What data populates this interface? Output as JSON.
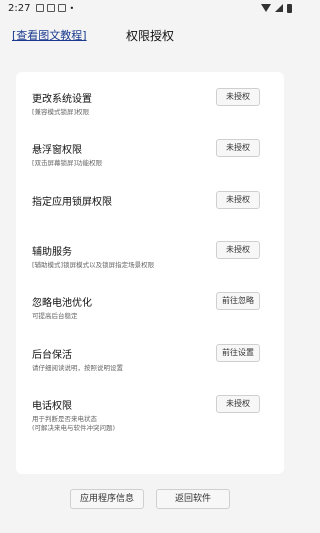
{
  "status_bar": {
    "time": "2:27",
    "icons": [
      "gallery-icon",
      "image-icon",
      "shield-icon",
      "dot-icon",
      "wifi-icon",
      "signal-icon",
      "battery-icon"
    ]
  },
  "header": {
    "help_link": "[查看图文教程]",
    "title": "权限授权"
  },
  "permissions": [
    {
      "title": "更改系统设置",
      "desc": "[兼容模式锁屏]权限",
      "button": "未授权"
    },
    {
      "title": "悬浮窗权限",
      "desc": "[双击屏幕锁屏]功能权限",
      "button": "未授权"
    },
    {
      "title": "指定应用锁屏权限",
      "desc": "",
      "button": "未授权"
    },
    {
      "title": "辅助服务",
      "desc": "[辅助模式]锁屏模式以及锁屏指定场景权限",
      "button": "未授权"
    },
    {
      "title": "忽略电池优化",
      "desc": "可提高后台稳定",
      "button": "前往忽略"
    },
    {
      "title": "后台保活",
      "desc": "请仔细阅读说明，按照说明设置",
      "button": "前往设置"
    },
    {
      "title": "电话权限",
      "desc": "用于判断是否来电状态",
      "desc2": "(可解决来电与软件冲突问题)",
      "button": "未授权"
    }
  ],
  "footer": {
    "app_info": "应用程序信息",
    "back": "返回软件"
  }
}
